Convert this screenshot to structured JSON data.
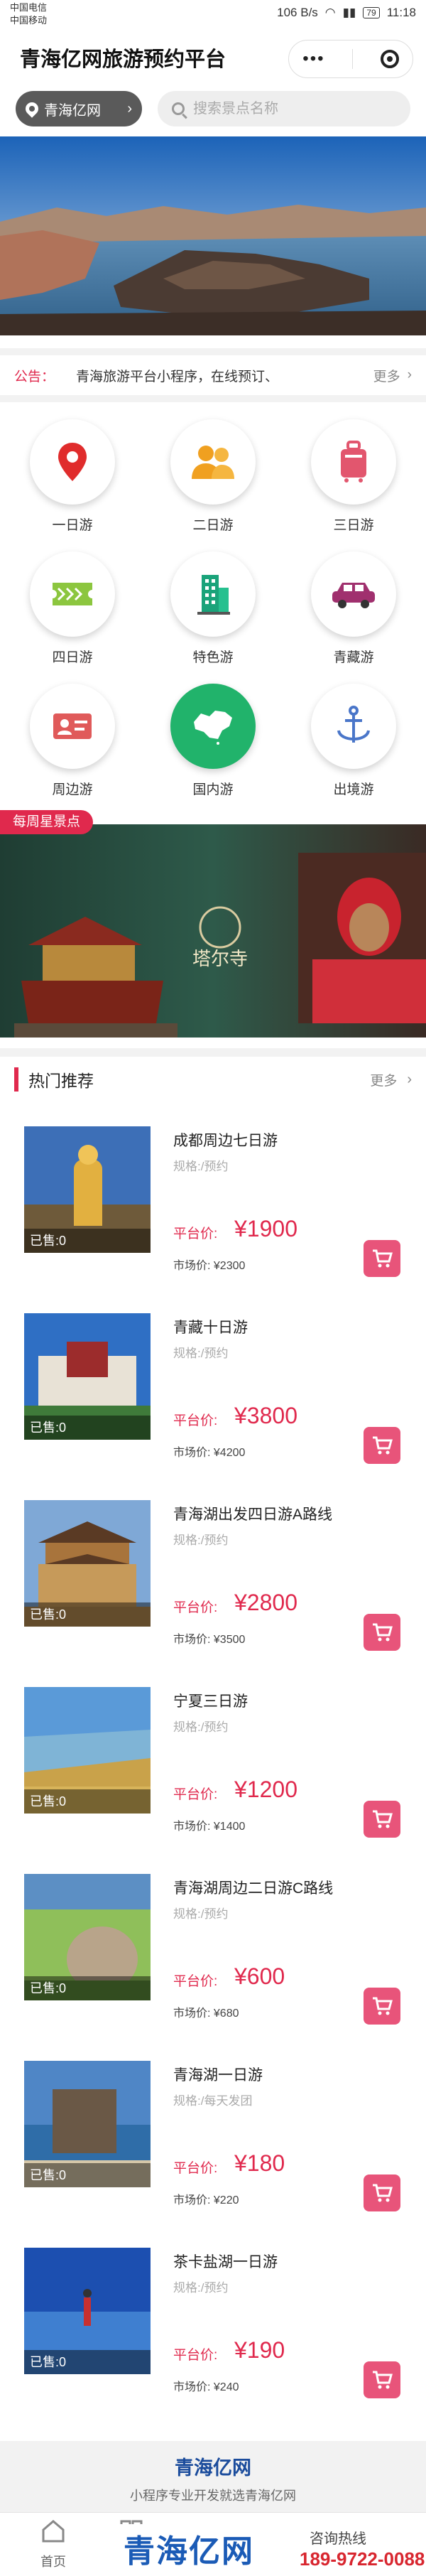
{
  "status_bar": {
    "carrier1": "中国电信",
    "carrier2": "中国移动",
    "speed": "106 B/s",
    "battery": "79",
    "time": "11:18"
  },
  "header": {
    "title": "青海亿网旅游预约平台"
  },
  "search": {
    "location": "青海亿网",
    "placeholder": "搜索景点名称"
  },
  "notice": {
    "label": "公告：",
    "text": "青海旅游平台小程序，在线预订、",
    "more": "更多"
  },
  "categories": [
    {
      "label": "一日游",
      "icon": "map-pin-icon"
    },
    {
      "label": "二日游",
      "icon": "people-icon"
    },
    {
      "label": "三日游",
      "icon": "luggage-icon"
    },
    {
      "label": "四日游",
      "icon": "ticket-icon"
    },
    {
      "label": "特色游",
      "icon": "building-icon"
    },
    {
      "label": "青藏游",
      "icon": "car-icon"
    },
    {
      "label": "周边游",
      "icon": "id-card-icon"
    },
    {
      "label": "国内游",
      "icon": "china-map-icon"
    },
    {
      "label": "出境游",
      "icon": "anchor-icon"
    }
  ],
  "weekly": {
    "tag": "每周星景点",
    "temple_name": "塔尔寺"
  },
  "hot": {
    "title": "热门推荐",
    "more": "更多"
  },
  "products": [
    {
      "name": "成都周边七日游",
      "spec": "规格:/预约",
      "price_label": "平台价:",
      "price": "¥1900",
      "market": "市场价: ¥2300",
      "sold": "已售:0"
    },
    {
      "name": "青藏十日游",
      "spec": "规格:/预约",
      "price_label": "平台价:",
      "price": "¥3800",
      "market": "市场价: ¥4200",
      "sold": "已售:0"
    },
    {
      "name": "青海湖出发四日游A路线",
      "spec": "规格:/预约",
      "price_label": "平台价:",
      "price": "¥2800",
      "market": "市场价: ¥3500",
      "sold": "已售:0"
    },
    {
      "name": "宁夏三日游",
      "spec": "规格:/预约",
      "price_label": "平台价:",
      "price": "¥1200",
      "market": "市场价: ¥1400",
      "sold": "已售:0"
    },
    {
      "name": "青海湖周边二日游C路线",
      "spec": "规格:/预约",
      "price_label": "平台价:",
      "price": "¥600",
      "market": "市场价: ¥680",
      "sold": "已售:0"
    },
    {
      "name": "青海湖一日游",
      "spec": "规格:/每天发团",
      "price_label": "平台价:",
      "price": "¥180",
      "market": "市场价: ¥220",
      "sold": "已售:0"
    },
    {
      "name": "茶卡盐湖一日游",
      "spec": "规格:/预约",
      "price_label": "平台价:",
      "price": "¥190",
      "market": "市场价: ¥240",
      "sold": "已售:0"
    }
  ],
  "footer": {
    "brand": "青海亿网",
    "slogan": "小程序专业开发就选青海亿网"
  },
  "tabbar": {
    "home": "首页"
  },
  "ad": {
    "brand": "青海亿网",
    "text": "咨询热线",
    "phone": "189-9722-0088"
  },
  "colors": {
    "accent": "#e0294d",
    "cart": "#e8547a",
    "brand_blue": "#1b4c9c"
  }
}
